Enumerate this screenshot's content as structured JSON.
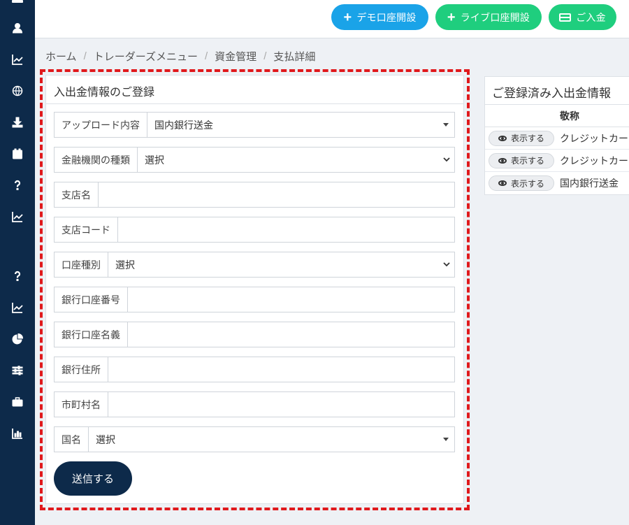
{
  "header": {
    "demo_btn": "デモ口座開設",
    "live_btn": "ライブ口座開設",
    "deposit_btn": "ご入金",
    "colors": {
      "demo": "#1aa3e8",
      "live": "#1fce7e",
      "sidebar": "#0d2a4a"
    }
  },
  "sidebar": {
    "icons": [
      "menu-icon",
      "user-icon",
      "chart-line-icon",
      "globe-icon",
      "download-icon",
      "calendar-icon",
      "question-icon",
      "chart-line-icon",
      "question-icon",
      "chart-line-icon",
      "pie-chart-icon",
      "sliders-icon",
      "briefcase-icon",
      "bar-chart-icon"
    ]
  },
  "breadcrumb": {
    "items": [
      "ホーム",
      "トレーダーズメニュー",
      "資金管理",
      "支払詳細"
    ],
    "sep": "/"
  },
  "form": {
    "title": "入出金情報のご登録",
    "fields": [
      {
        "label": "アップロード内容",
        "value": "国内銀行送金"
      },
      {
        "label": "金融機関の種類",
        "value": "選択"
      },
      {
        "label": "支店名",
        "value": ""
      },
      {
        "label": "支店コード",
        "value": ""
      },
      {
        "label": "口座種別",
        "value": "選択"
      },
      {
        "label": "銀行口座番号",
        "value": ""
      },
      {
        "label": "銀行口座名義",
        "value": ""
      },
      {
        "label": "銀行住所",
        "value": ""
      },
      {
        "label": "市町村名",
        "value": ""
      },
      {
        "label": "国名",
        "value": "選択"
      }
    ],
    "submit": "送信する"
  },
  "registered": {
    "title": "ご登録済み入出金情報",
    "col_name": "敬称",
    "rows": [
      {
        "btn": "表示する",
        "name": "クレジットカー"
      },
      {
        "btn": "表示する",
        "name": "クレジットカー"
      },
      {
        "btn": "表示する",
        "name": "国内銀行送金"
      }
    ]
  }
}
